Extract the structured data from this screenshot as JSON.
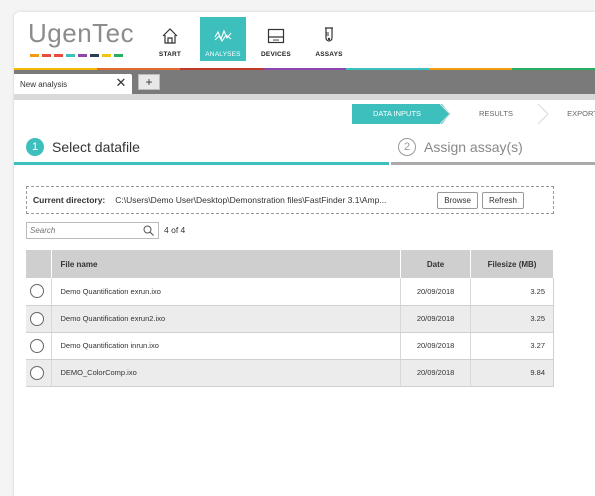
{
  "app": {
    "logo_text": "UgenTec",
    "logo_colors": [
      "#f39c12",
      "#e74c3c",
      "#3dbfbd",
      "#8e44ad",
      "#2c3e50",
      "#f1c40f",
      "#27ae60"
    ]
  },
  "nav": {
    "items": [
      {
        "label": "START",
        "icon": "home-icon"
      },
      {
        "label": "ANALYSES",
        "icon": "analyses-icon",
        "active": true
      },
      {
        "label": "DEVICES",
        "icon": "devices-icon"
      },
      {
        "label": "ASSAYS",
        "icon": "assays-icon"
      }
    ],
    "rainbow_colors": [
      "#f5b800",
      "#e06a2b",
      "#c0392b",
      "#8e44ad",
      "#3dbfbd",
      "#f39c12",
      "#27ae60"
    ]
  },
  "tabs": {
    "items": [
      {
        "label": "New analysis",
        "close": "✕"
      }
    ],
    "add_label": "+"
  },
  "wizard": {
    "steps": [
      {
        "label": "DATA INPUTS",
        "active": true
      },
      {
        "label": "RESULTS"
      },
      {
        "label": "EXPORTS"
      }
    ]
  },
  "steps": {
    "step1": {
      "number": "1",
      "title": "Select datafile"
    },
    "step2": {
      "number": "2",
      "title": "Assign assay(s)"
    }
  },
  "directory": {
    "label": "Current directory:",
    "path": "C:\\Users\\Demo User\\Desktop\\Demonstration files\\FastFinder 3.1\\Amp...",
    "browse_label": "Browse",
    "refresh_label": "Refresh"
  },
  "search": {
    "placeholder": "Search",
    "count": "4 of 4"
  },
  "table": {
    "headers": {
      "file": "File name",
      "date": "Date",
      "size": "Filesize (MB)"
    },
    "rows": [
      {
        "file": "Demo Quantification exrun.ixo",
        "date": "20/09/2018",
        "size": "3.25"
      },
      {
        "file": "Demo Quantification exrun2.ixo",
        "date": "20/09/2018",
        "size": "3.25"
      },
      {
        "file": "Demo Quantification inrun.ixo",
        "date": "20/09/2018",
        "size": "3.27"
      },
      {
        "file": "DEMO_ColorComp.ixo",
        "date": "20/09/2018",
        "size": "9.84"
      }
    ]
  },
  "colors": {
    "accent": "#3dbfbd",
    "tabstrip": "#7a7a7a",
    "header_row": "#cfcfcf"
  }
}
